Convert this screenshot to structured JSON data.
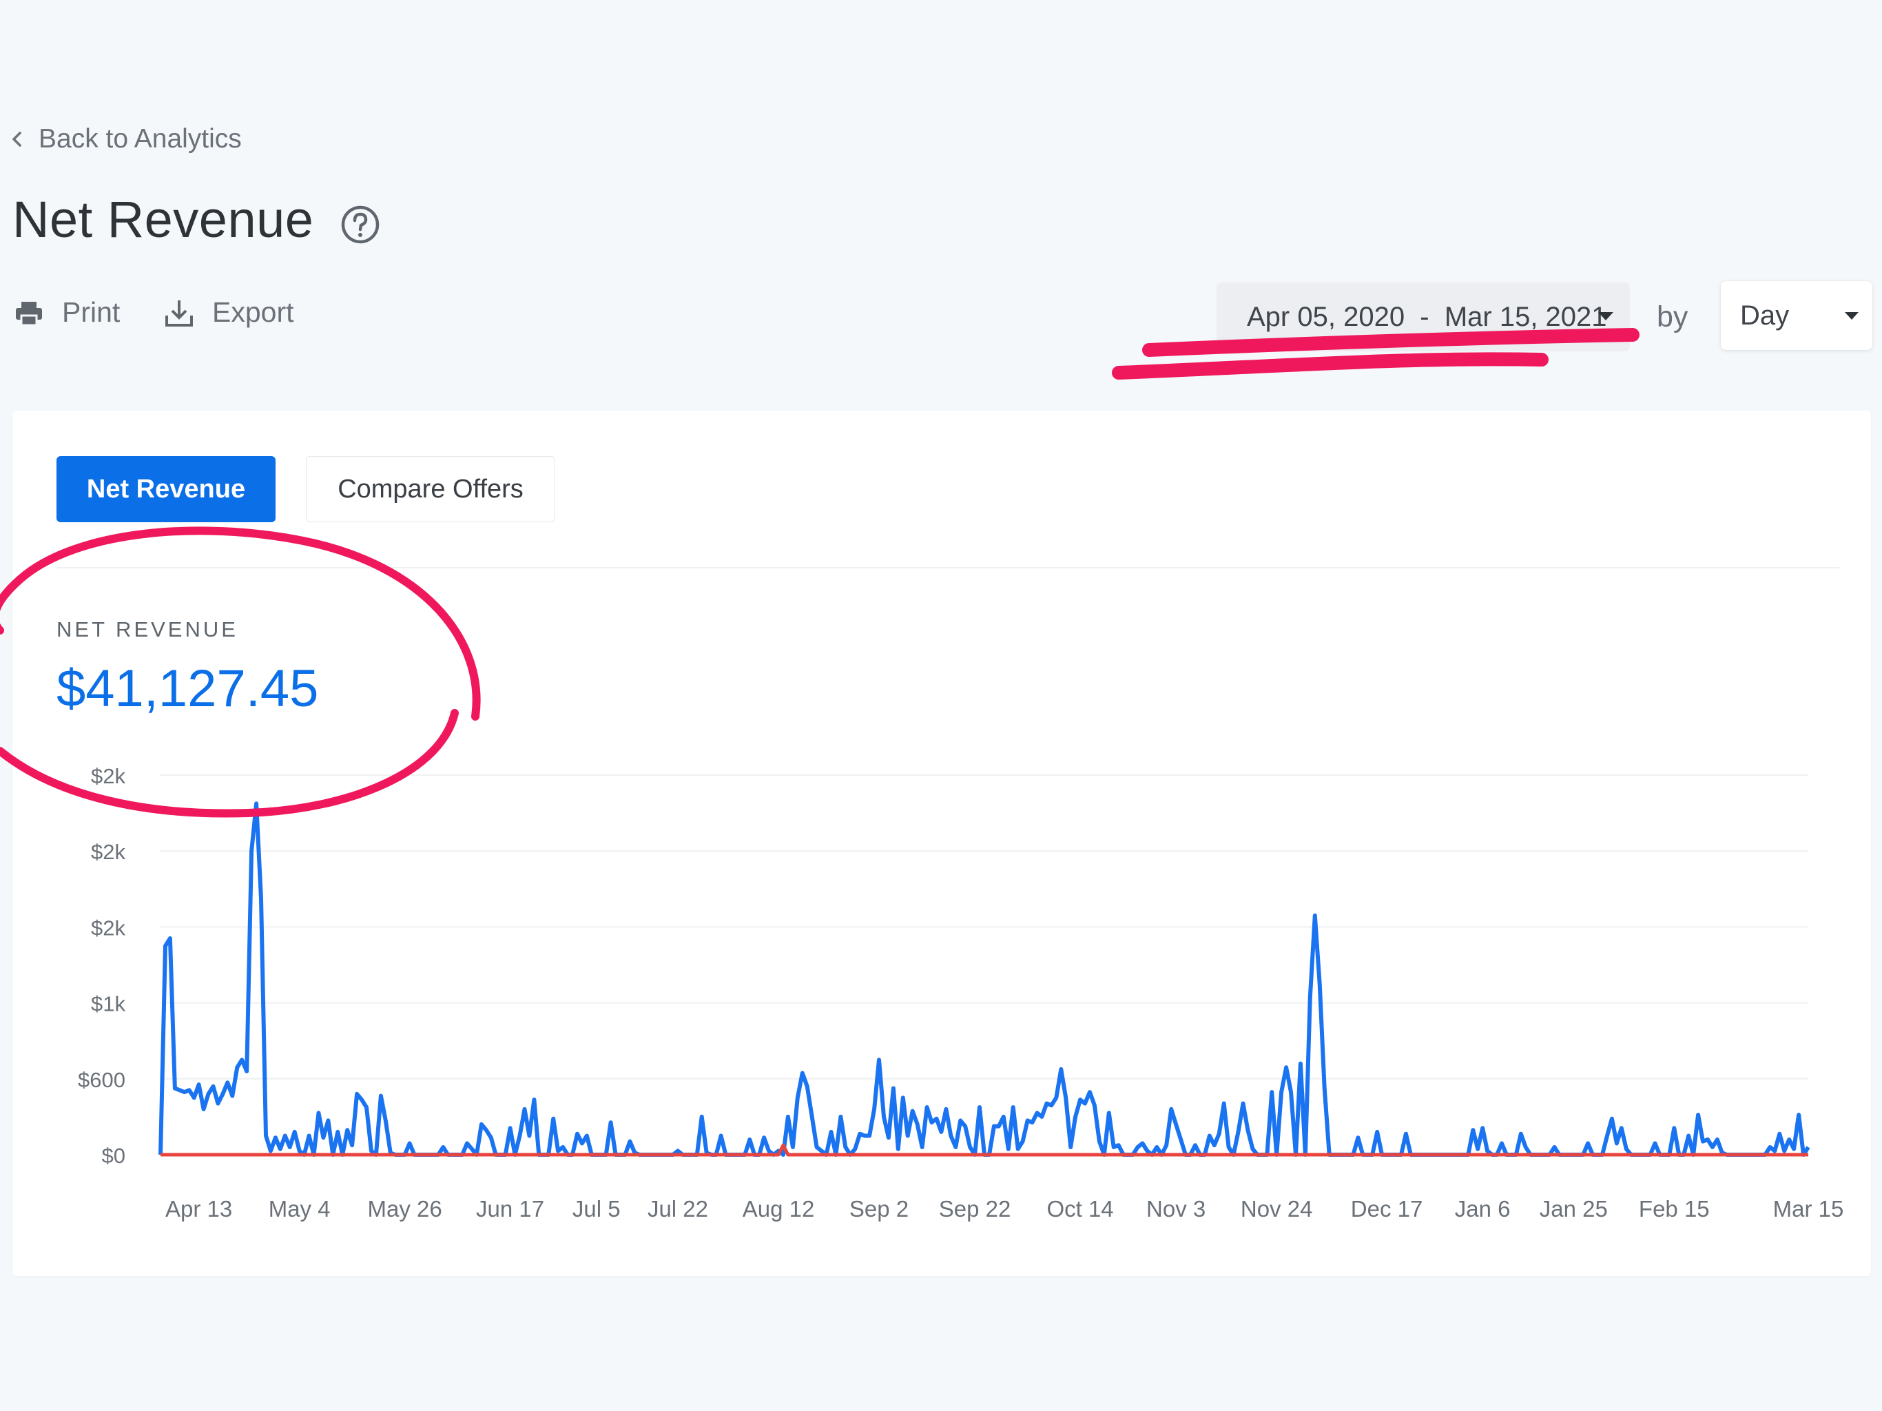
{
  "nav": {
    "back_label": "Back to Analytics"
  },
  "page": {
    "title": "Net Revenue"
  },
  "toolbar": {
    "print_label": "Print",
    "export_label": "Export",
    "date_range": "Apr 05, 2020  -  Mar 15, 2021",
    "by_label": "by",
    "period": "Day"
  },
  "tabs": [
    {
      "label": "Net Revenue",
      "active": true
    },
    {
      "label": "Compare Offers",
      "active": false
    }
  ],
  "metric": {
    "label": "NET REVENUE",
    "value": "$41,127.45"
  },
  "colors": {
    "accent": "#0b6fe8",
    "line": "#1a73f0",
    "baseline": "#e8443f",
    "annotation": "#f0185c"
  },
  "icons": [
    "chevron-left-icon",
    "help-circle-icon",
    "printer-icon",
    "download-icon",
    "caret-down-icon"
  ],
  "chart_data": {
    "type": "line",
    "title": "",
    "xlabel": "",
    "ylabel": "",
    "ylim": [
      0,
      2000
    ],
    "y_ticks": [
      0,
      400,
      800,
      1200,
      1600,
      2000
    ],
    "y_tick_labels": [
      "$0",
      "$600",
      "$1k",
      "$2k",
      "$2k",
      "$2k"
    ],
    "x_range": [
      "2020-04-05",
      "2021-03-15"
    ],
    "x_ticks": [
      "2020-04-13",
      "2020-05-04",
      "2020-05-26",
      "2020-06-17",
      "2020-07-05",
      "2020-07-22",
      "2020-08-12",
      "2020-09-02",
      "2020-09-22",
      "2020-10-14",
      "2020-11-03",
      "2020-11-24",
      "2020-12-17",
      "2021-01-06",
      "2021-01-25",
      "2021-02-15",
      "2021-03-15"
    ],
    "x_tick_labels": [
      "Apr 13",
      "May 4",
      "May 26",
      "Jun 17",
      "Jul 5",
      "Jul 22",
      "Aug 12",
      "Sep 2",
      "Sep 22",
      "Oct 14",
      "Nov 3",
      "Nov 24",
      "Dec 17",
      "Jan 6",
      "Jan 25",
      "Feb 15",
      "Mar 15"
    ],
    "grid": true,
    "legend": "none",
    "series": [
      {
        "color": "#1a73f0",
        "points": [
          [
            "2020-04-05",
            0
          ],
          [
            "2020-04-06",
            1100
          ],
          [
            "2020-04-07",
            1140
          ],
          [
            "2020-04-08",
            350
          ],
          [
            "2020-04-09",
            340
          ],
          [
            "2020-04-10",
            330
          ],
          [
            "2020-04-11",
            340
          ],
          [
            "2020-04-12",
            300
          ],
          [
            "2020-04-13",
            370
          ],
          [
            "2020-04-14",
            240
          ],
          [
            "2020-04-15",
            320
          ],
          [
            "2020-04-16",
            360
          ],
          [
            "2020-04-17",
            270
          ],
          [
            "2020-04-18",
            320
          ],
          [
            "2020-04-19",
            380
          ],
          [
            "2020-04-20",
            310
          ],
          [
            "2020-04-21",
            460
          ],
          [
            "2020-04-22",
            500
          ],
          [
            "2020-04-23",
            440
          ],
          [
            "2020-04-24",
            1600
          ],
          [
            "2020-04-25",
            1850
          ],
          [
            "2020-04-26",
            1350
          ],
          [
            "2020-04-27",
            100
          ],
          [
            "2020-04-28",
            20
          ],
          [
            "2020-04-29",
            90
          ],
          [
            "2020-04-30",
            30
          ],
          [
            "2020-05-01",
            100
          ],
          [
            "2020-05-02",
            40
          ],
          [
            "2020-05-03",
            120
          ],
          [
            "2020-05-04",
            20
          ],
          [
            "2020-05-06",
            100
          ],
          [
            "2020-05-08",
            220
          ],
          [
            "2020-05-09",
            90
          ],
          [
            "2020-05-10",
            180
          ],
          [
            "2020-05-12",
            120
          ],
          [
            "2020-05-14",
            130
          ],
          [
            "2020-05-15",
            50
          ],
          [
            "2020-05-16",
            320
          ],
          [
            "2020-05-17",
            290
          ],
          [
            "2020-05-18",
            250
          ],
          [
            "2020-05-19",
            20
          ],
          [
            "2020-05-21",
            310
          ],
          [
            "2020-05-22",
            180
          ],
          [
            "2020-05-23",
            10
          ],
          [
            "2020-05-27",
            60
          ],
          [
            "2020-05-28",
            0
          ],
          [
            "2020-06-03",
            40
          ],
          [
            "2020-06-04",
            0
          ],
          [
            "2020-06-08",
            60
          ],
          [
            "2020-06-09",
            30
          ],
          [
            "2020-06-11",
            160
          ],
          [
            "2020-06-12",
            130
          ],
          [
            "2020-06-13",
            90
          ],
          [
            "2020-06-14",
            0
          ],
          [
            "2020-06-17",
            140
          ],
          [
            "2020-06-19",
            100
          ],
          [
            "2020-06-20",
            240
          ],
          [
            "2020-06-21",
            100
          ],
          [
            "2020-06-22",
            290
          ],
          [
            "2020-06-23",
            0
          ],
          [
            "2020-06-26",
            190
          ],
          [
            "2020-06-27",
            20
          ],
          [
            "2020-06-28",
            40
          ],
          [
            "2020-06-30",
            0
          ],
          [
            "2020-07-01",
            110
          ],
          [
            "2020-07-02",
            60
          ],
          [
            "2020-07-03",
            100
          ],
          [
            "2020-07-04",
            0
          ],
          [
            "2020-07-08",
            170
          ],
          [
            "2020-07-09",
            0
          ],
          [
            "2020-07-12",
            70
          ],
          [
            "2020-07-13",
            10
          ],
          [
            "2020-07-14",
            0
          ],
          [
            "2020-07-22",
            20
          ],
          [
            "2020-07-23",
            0
          ],
          [
            "2020-07-27",
            200
          ],
          [
            "2020-07-28",
            10
          ],
          [
            "2020-07-30",
            0
          ],
          [
            "2020-07-31",
            100
          ],
          [
            "2020-08-01",
            0
          ],
          [
            "2020-08-06",
            80
          ],
          [
            "2020-08-07",
            0
          ],
          [
            "2020-08-09",
            90
          ],
          [
            "2020-08-10",
            20
          ],
          [
            "2020-08-11",
            0
          ],
          [
            "2020-08-12",
            20
          ],
          [
            "2020-08-14",
            200
          ],
          [
            "2020-08-15",
            40
          ],
          [
            "2020-08-16",
            300
          ],
          [
            "2020-08-17",
            430
          ],
          [
            "2020-08-18",
            360
          ],
          [
            "2020-08-19",
            200
          ],
          [
            "2020-08-20",
            40
          ],
          [
            "2020-08-21",
            20
          ],
          [
            "2020-08-23",
            120
          ],
          [
            "2020-08-25",
            200
          ],
          [
            "2020-08-26",
            40
          ],
          [
            "2020-08-28",
            30
          ],
          [
            "2020-08-29",
            110
          ],
          [
            "2020-08-30",
            100
          ],
          [
            "2020-08-31",
            100
          ],
          [
            "2020-09-01",
            240
          ],
          [
            "2020-09-02",
            500
          ],
          [
            "2020-09-03",
            200
          ],
          [
            "2020-09-04",
            90
          ],
          [
            "2020-09-05",
            350
          ],
          [
            "2020-09-06",
            30
          ],
          [
            "2020-09-07",
            300
          ],
          [
            "2020-09-08",
            100
          ],
          [
            "2020-09-09",
            230
          ],
          [
            "2020-09-10",
            160
          ],
          [
            "2020-09-11",
            40
          ],
          [
            "2020-09-12",
            250
          ],
          [
            "2020-09-13",
            170
          ],
          [
            "2020-09-14",
            190
          ],
          [
            "2020-09-15",
            120
          ],
          [
            "2020-09-16",
            240
          ],
          [
            "2020-09-17",
            100
          ],
          [
            "2020-09-18",
            40
          ],
          [
            "2020-09-19",
            180
          ],
          [
            "2020-09-20",
            150
          ],
          [
            "2020-09-21",
            40
          ],
          [
            "2020-09-23",
            250
          ],
          [
            "2020-09-24",
            0
          ],
          [
            "2020-09-26",
            150
          ],
          [
            "2020-09-27",
            150
          ],
          [
            "2020-09-28",
            200
          ],
          [
            "2020-09-29",
            30
          ],
          [
            "2020-09-30",
            250
          ],
          [
            "2020-10-01",
            30
          ],
          [
            "2020-10-02",
            70
          ],
          [
            "2020-10-03",
            180
          ],
          [
            "2020-10-04",
            170
          ],
          [
            "2020-10-05",
            220
          ],
          [
            "2020-10-06",
            200
          ],
          [
            "2020-10-07",
            270
          ],
          [
            "2020-10-08",
            260
          ],
          [
            "2020-10-09",
            300
          ],
          [
            "2020-10-10",
            450
          ],
          [
            "2020-10-11",
            300
          ],
          [
            "2020-10-12",
            40
          ],
          [
            "2020-10-13",
            200
          ],
          [
            "2020-10-14",
            290
          ],
          [
            "2020-10-15",
            270
          ],
          [
            "2020-10-16",
            330
          ],
          [
            "2020-10-17",
            260
          ],
          [
            "2020-10-18",
            70
          ],
          [
            "2020-10-20",
            220
          ],
          [
            "2020-10-21",
            40
          ],
          [
            "2020-10-22",
            50
          ],
          [
            "2020-10-23",
            0
          ],
          [
            "2020-10-26",
            40
          ],
          [
            "2020-10-27",
            60
          ],
          [
            "2020-10-28",
            20
          ],
          [
            "2020-10-30",
            40
          ],
          [
            "2020-10-31",
            0
          ],
          [
            "2020-11-01",
            50
          ],
          [
            "2020-11-02",
            240
          ],
          [
            "2020-11-03",
            160
          ],
          [
            "2020-11-04",
            80
          ],
          [
            "2020-11-05",
            0
          ],
          [
            "2020-11-07",
            50
          ],
          [
            "2020-11-08",
            0
          ],
          [
            "2020-11-10",
            100
          ],
          [
            "2020-11-11",
            50
          ],
          [
            "2020-11-12",
            110
          ],
          [
            "2020-11-13",
            270
          ],
          [
            "2020-11-14",
            40
          ],
          [
            "2020-11-15",
            0
          ],
          [
            "2020-11-16",
            120
          ],
          [
            "2020-11-17",
            270
          ],
          [
            "2020-11-18",
            130
          ],
          [
            "2020-11-19",
            30
          ],
          [
            "2020-11-20",
            0
          ],
          [
            "2020-11-23",
            330
          ],
          [
            "2020-11-24",
            0
          ],
          [
            "2020-11-25",
            330
          ],
          [
            "2020-11-26",
            460
          ],
          [
            "2020-11-27",
            330
          ],
          [
            "2020-11-28",
            0
          ],
          [
            "2020-11-29",
            480
          ],
          [
            "2020-11-30",
            0
          ],
          [
            "2020-12-01",
            830
          ],
          [
            "2020-12-02",
            1260
          ],
          [
            "2020-12-03",
            900
          ],
          [
            "2020-12-04",
            350
          ],
          [
            "2020-12-05",
            0
          ],
          [
            "2020-12-11",
            90
          ],
          [
            "2020-12-12",
            0
          ],
          [
            "2020-12-15",
            120
          ],
          [
            "2020-12-16",
            0
          ],
          [
            "2020-12-21",
            110
          ],
          [
            "2020-12-22",
            0
          ],
          [
            "2021-01-04",
            130
          ],
          [
            "2021-01-05",
            30
          ],
          [
            "2021-01-06",
            140
          ],
          [
            "2021-01-07",
            20
          ],
          [
            "2021-01-08",
            0
          ],
          [
            "2021-01-10",
            60
          ],
          [
            "2021-01-11",
            0
          ],
          [
            "2021-01-14",
            110
          ],
          [
            "2021-01-15",
            40
          ],
          [
            "2021-01-16",
            0
          ],
          [
            "2021-01-21",
            40
          ],
          [
            "2021-01-22",
            0
          ],
          [
            "2021-01-28",
            60
          ],
          [
            "2021-01-29",
            0
          ],
          [
            "2021-02-01",
            100
          ],
          [
            "2021-02-02",
            190
          ],
          [
            "2021-02-03",
            60
          ],
          [
            "2021-02-04",
            140
          ],
          [
            "2021-02-05",
            30
          ],
          [
            "2021-02-06",
            0
          ],
          [
            "2021-02-11",
            60
          ],
          [
            "2021-02-12",
            0
          ],
          [
            "2021-02-15",
            140
          ],
          [
            "2021-02-16",
            0
          ],
          [
            "2021-02-18",
            100
          ],
          [
            "2021-02-19",
            0
          ],
          [
            "2021-02-20",
            210
          ],
          [
            "2021-02-21",
            70
          ],
          [
            "2021-02-22",
            80
          ],
          [
            "2021-02-23",
            40
          ],
          [
            "2021-02-24",
            80
          ],
          [
            "2021-02-25",
            10
          ],
          [
            "2021-02-26",
            0
          ],
          [
            "2021-03-07",
            40
          ],
          [
            "2021-03-08",
            20
          ],
          [
            "2021-03-09",
            110
          ],
          [
            "2021-03-10",
            20
          ],
          [
            "2021-03-11",
            80
          ],
          [
            "2021-03-12",
            30
          ],
          [
            "2021-03-13",
            210
          ],
          [
            "2021-03-14",
            0
          ],
          [
            "2021-03-15",
            40
          ]
        ]
      },
      {
        "color": "#e8443f",
        "points": [
          [
            "2020-04-05",
            0
          ],
          [
            "2020-08-12",
            0
          ],
          [
            "2020-08-13",
            50
          ],
          [
            "2020-08-14",
            0
          ],
          [
            "2021-03-15",
            0
          ]
        ]
      }
    ]
  }
}
